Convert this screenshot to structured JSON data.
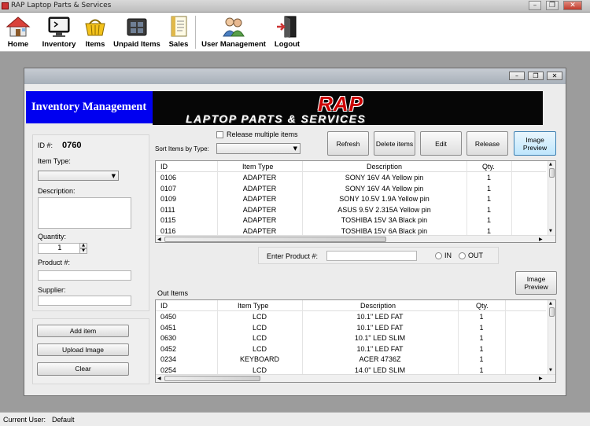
{
  "window": {
    "title": "RAP Laptop Parts & Services",
    "controls": {
      "minimize": "–",
      "restore": "❐",
      "close": "✕"
    }
  },
  "toolbar": [
    {
      "key": "home",
      "label": "Home",
      "icon": "home-icon"
    },
    {
      "key": "inventory",
      "label": "Inventory",
      "icon": "monitor-icon"
    },
    {
      "key": "items",
      "label": "Items",
      "icon": "basket-icon"
    },
    {
      "key": "unpaid",
      "label": "Unpaid Items",
      "icon": "folder-icon"
    },
    {
      "key": "sales",
      "label": "Sales",
      "icon": "document-icon"
    },
    {
      "key": "users",
      "label": "User Management",
      "icon": "users-icon"
    },
    {
      "key": "logout",
      "label": "Logout",
      "icon": "exit-door-icon"
    }
  ],
  "inventory": {
    "header": "Inventory Management",
    "banner": {
      "line1": "RAP",
      "line2": "LAPTOP PARTS & SERVICES"
    },
    "id_label": "ID #:",
    "id_value": "0760",
    "item_type_label": "Item Type:",
    "item_type_value": "",
    "description_label": "Description:",
    "description_value": "",
    "quantity_label": "Quantity:",
    "quantity_value": "1",
    "product_label": "Product #:",
    "product_value": "",
    "supplier_label": "Supplier:",
    "supplier_value": "",
    "buttons": {
      "add": "Add item",
      "upload": "Upload Image",
      "clear": "Clear"
    },
    "release_multiple_label": "Release multiple items",
    "sort_label": "Sort Items by Type:",
    "sort_value": "",
    "actions": {
      "refresh": "Refresh",
      "delete": "Delete items",
      "edit": "Edit",
      "release": "Release",
      "preview": "Image Preview"
    },
    "columns": [
      "ID",
      "Item Type",
      "Description",
      "Qty."
    ],
    "items": [
      {
        "id": "0106",
        "type": "ADAPTER",
        "desc": "SONY 16V 4A Yellow pin",
        "qty": "1"
      },
      {
        "id": "0107",
        "type": "ADAPTER",
        "desc": "SONY 16V 4A  Yellow pin",
        "qty": "1"
      },
      {
        "id": "0109",
        "type": "ADAPTER",
        "desc": "SONY 10.5V 1.9A Yellow pin",
        "qty": "1"
      },
      {
        "id": "0111",
        "type": "ADAPTER",
        "desc": "ASUS 9.5V 2.315A Yellow pin",
        "qty": "1"
      },
      {
        "id": "0115",
        "type": "ADAPTER",
        "desc": "TOSHIBA 15V 3A Black pin",
        "qty": "1"
      },
      {
        "id": "0116",
        "type": "ADAPTER",
        "desc": "TOSHIBA 15V 6A Black pin",
        "qty": "1"
      }
    ],
    "enter_product_label": "Enter Product #:",
    "enter_product_value": "",
    "radio_in": "IN",
    "radio_out": "OUT",
    "out_items_label": "Out Items",
    "out_preview": "Image Preview",
    "out_items": [
      {
        "id": "0450",
        "type": "LCD",
        "desc": "10.1\" LED FAT",
        "qty": "1"
      },
      {
        "id": "0451",
        "type": "LCD",
        "desc": "10.1\" LED FAT",
        "qty": "1"
      },
      {
        "id": "0630",
        "type": "LCD",
        "desc": "10.1\" LED SLIM",
        "qty": "1"
      },
      {
        "id": "0452",
        "type": "LCD",
        "desc": "10.1\" LED FAT",
        "qty": "1"
      },
      {
        "id": "0234",
        "type": "KEYBOARD",
        "desc": "ACER 4736Z",
        "qty": "1"
      },
      {
        "id": "0254",
        "type": "LCD",
        "desc": "14.0\" LED SLIM",
        "qty": "1"
      }
    ]
  },
  "status": {
    "label": "Current User:",
    "value": "Default"
  }
}
